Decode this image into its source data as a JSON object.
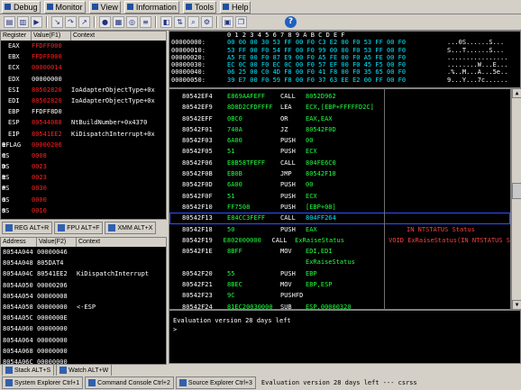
{
  "menu": {
    "items": [
      "Debug",
      "Monitor",
      "View",
      "Information",
      "Tools",
      "Help"
    ]
  },
  "registers": {
    "headers": [
      "Register",
      "Value(F1)",
      "Context"
    ],
    "rows": [
      {
        "name": "EAX",
        "value": "FFDFF000",
        "ctx": ""
      },
      {
        "name": "EBX",
        "value": "FFDFF000",
        "ctx": ""
      },
      {
        "name": "ECX",
        "value": "00000014",
        "ctx": ""
      },
      {
        "name": "EDX",
        "value": "00000000",
        "ctx": ""
      },
      {
        "name": "ESI",
        "value": "80502820",
        "ctx": "IoAdapterObjectType+0x"
      },
      {
        "name": "EDI",
        "value": "80502820",
        "ctx": "IoAdapterObjectType+0x"
      },
      {
        "name": "EBP",
        "value": "FFDFF8D0",
        "ctx": ""
      },
      {
        "name": "ESP",
        "value": "80544088",
        "ctx": "NtBuildNumber+0x4370"
      },
      {
        "name": "EIP",
        "value": "80541EE2",
        "ctx": "KiDispatchInterrupt+0x"
      },
      {
        "name": "EFLAG",
        "value": "00000206",
        "ctx": ""
      },
      {
        "name": "CS",
        "value": "0008",
        "ctx": ""
      },
      {
        "name": "DS",
        "value": "0023",
        "ctx": ""
      },
      {
        "name": "ES",
        "value": "0023",
        "ctx": ""
      },
      {
        "name": "FS",
        "value": "0030",
        "ctx": ""
      },
      {
        "name": "GS",
        "value": "0000",
        "ctx": ""
      },
      {
        "name": "SS",
        "value": "0010",
        "ctx": ""
      }
    ]
  },
  "reg_tabs": [
    "REG ALT+R",
    "FPU ALT+F",
    "XMM ALT+X"
  ],
  "stack": {
    "headers": [
      "Address",
      "Value(F2)",
      "Context"
    ],
    "rows": [
      {
        "addr": "8054A044",
        "val": "00000046",
        "ctx": ""
      },
      {
        "addr": "8054A048",
        "val": "805DAT4",
        "ctx": ""
      },
      {
        "addr": "8054A04C",
        "val": "80541EE2",
        "ctx": "KiDispatchInterrupt"
      },
      {
        "addr": "8054A050",
        "val": "00000206",
        "ctx": ""
      },
      {
        "addr": "8054A054",
        "val": "00000008",
        "ctx": ""
      },
      {
        "addr": "8054A058",
        "val": "00000000",
        "ctx": "<-ESP"
      },
      {
        "addr": "8054A05C",
        "val": "0000000E",
        "ctx": ""
      },
      {
        "addr": "8054A060",
        "val": "00000000",
        "ctx": ""
      },
      {
        "addr": "8054A064",
        "val": "00000000",
        "ctx": ""
      },
      {
        "addr": "8054A068",
        "val": "00000000",
        "ctx": ""
      },
      {
        "addr": "8054A06C",
        "val": "00000000",
        "ctx": ""
      }
    ]
  },
  "stack_tabs": [
    "Stack ALT+S",
    "Watch ALT+W"
  ],
  "dump": {
    "header": "0 1 2 3 4 5 6 7 8 9 A B C D E F",
    "rows": [
      {
        "addr": "00000000:",
        "hex": "00 00 00 30 53 FF 00 F0 C3 E2 00 F0 53 FF 00 F0",
        "ascii": "...0S......S..."
      },
      {
        "addr": "00000010:",
        "hex": "53 FF 00 F0 54 FF 00 F0 99 00 00 F0 53 FF 00 F0",
        "ascii": "S...T......S..."
      },
      {
        "addr": "00000020:",
        "hex": "A5 FE 00 F0 87 E9 00 F0 A5 FE 00 F0 A5 FE 00 F0",
        "ascii": "................"
      },
      {
        "addr": "00000030:",
        "hex": "EC 0C 00 F0 EC 0C 00 F0 57 EF 00 F0 45 F5 00 F0",
        "ascii": "........W...E..."
      },
      {
        "addr": "00000040:",
        "hex": "06 25 00 C0 4D F8 00 F0 41 F8 00 F0 35 65 00 F0",
        "ascii": ".%..M...A...5e.."
      },
      {
        "addr": "00000050:",
        "hex": "39 E7 00 F0 59 F8 00 F0 37 63 EE E2 00 FF 00 F0",
        "ascii": "9...Y...7c......"
      }
    ]
  },
  "code": {
    "rows": [
      {
        "addr": "80542EF4",
        "bytes": "E869AAFEFF",
        "op": "CALL",
        "args": "8052D962",
        "cmt": ""
      },
      {
        "addr": "80542EF9",
        "bytes": "8D8D2CFDFFFF",
        "op": "LEA",
        "args": "ECX,[EBP+FFFFFD2C]",
        "cmt": ""
      },
      {
        "addr": "80542EFF",
        "bytes": "0BC0",
        "op": "OR",
        "args": "EAX,EAX",
        "cmt": ""
      },
      {
        "addr": "80542F01",
        "bytes": "740A",
        "op": "JZ",
        "args": "80542F0D",
        "cmt": ""
      },
      {
        "addr": "80542F03",
        "bytes": "6A00",
        "op": "PUSH",
        "args": "00",
        "cmt": ""
      },
      {
        "addr": "80542F05",
        "bytes": "51",
        "op": "PUSH",
        "args": "ECX",
        "cmt": ""
      },
      {
        "addr": "80542F06",
        "bytes": "E8B58TFEFF",
        "op": "CALL",
        "args": "804FE6C0",
        "cmt": ""
      },
      {
        "addr": "80542F0B",
        "bytes": "EB0B",
        "op": "JMP",
        "args": "80542F18",
        "cmt": ""
      },
      {
        "addr": "80542F0D",
        "bytes": "6A00",
        "op": "PUSH",
        "args": "00",
        "cmt": ""
      },
      {
        "addr": "80542F0F",
        "bytes": "51",
        "op": "PUSH",
        "args": "ECX",
        "cmt": ""
      },
      {
        "addr": "80542F10",
        "bytes": "FF7508",
        "op": "PUSH",
        "args": "[EBP+08]",
        "cmt": ""
      },
      {
        "addr": "80542F13",
        "bytes": "E84CC3FEFF",
        "op": "CALL",
        "args": "804FF264",
        "cmt": ""
      },
      {
        "addr": "80542F18",
        "bytes": "50",
        "op": "PUSH",
        "args": "EAX",
        "cmt": "IN NTSTATUS Status"
      },
      {
        "addr": "80542F19",
        "bytes": "E802000000",
        "op": "CALL",
        "args": "ExRaiseStatus",
        "cmt": "VOID ExRaiseStatus(IN NTSTATUS S"
      },
      {
        "addr": "80542F1E",
        "bytes": "8BFF",
        "op": "MOV",
        "args": "EDI,EDI",
        "cmt": ""
      },
      {
        "addr": "",
        "bytes": "",
        "op": "",
        "args": "ExRaiseStatus",
        "cmt": ""
      },
      {
        "addr": "80542F20",
        "bytes": "55",
        "op": "PUSH",
        "args": "EBP",
        "cmt": ""
      },
      {
        "addr": "80542F21",
        "bytes": "8BEC",
        "op": "MOV",
        "args": "EBP,ESP",
        "cmt": ""
      },
      {
        "addr": "80542F23",
        "bytes": "9C",
        "op": "PUSHFD",
        "args": "",
        "cmt": ""
      },
      {
        "addr": "80542F24",
        "bytes": "81EC20030000",
        "op": "SUB",
        "args": "ESP,00000320",
        "cmt": ""
      }
    ]
  },
  "console": {
    "line1": "Evaluation version 28 days left",
    "prompt": ">"
  },
  "bottom_tabs": [
    "System Explorer Ctrl+1",
    "Command Console Ctrl+2",
    "Source Explorer Ctrl+3"
  ],
  "status": "Evaluation version 28 days left --- csrss"
}
